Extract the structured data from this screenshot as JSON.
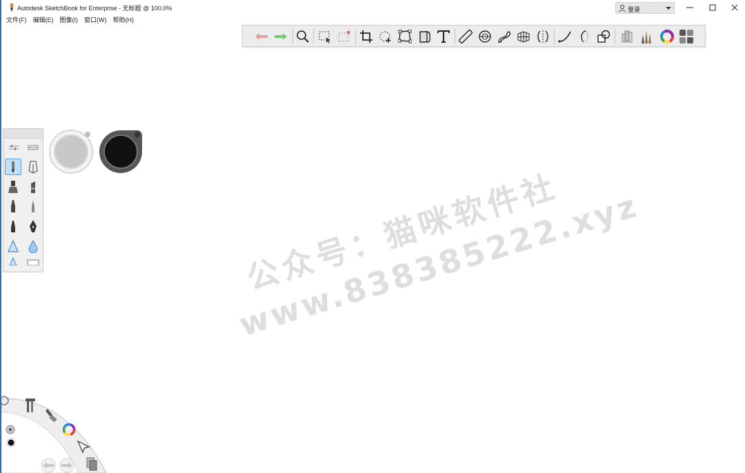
{
  "window": {
    "title": "Autodesk SketchBook for Enterprise - 无标题 @ 100.0%",
    "login_label": "登录",
    "controls": [
      "minimize",
      "maximize",
      "close"
    ]
  },
  "menu": {
    "items": [
      "文件(F)",
      "编辑(E)",
      "图像(I)",
      "窗口(W)",
      "帮助(H)"
    ]
  },
  "toolbar": {
    "tools": [
      "undo-icon",
      "redo-icon",
      "zoom-icon",
      "select-icon",
      "transform-select-icon",
      "crop-icon",
      "move-rotate-icon",
      "distort-icon",
      "layer-fill-icon",
      "text-icon",
      "ruler-icon",
      "ellipse-guide-icon",
      "french-curve-icon",
      "perspective-icon",
      "symmetry-icon",
      "stroke-icon",
      "predictive-stroke-icon",
      "shape-icon",
      "copic-library-icon",
      "brush-library-icon",
      "color-wheel-icon",
      "layer-editor-icon"
    ]
  },
  "brush_palette": {
    "brushes": [
      "pencil-icon",
      "ink-pen-icon",
      "marker-icon",
      "chisel-marker-icon",
      "felt-pen-icon",
      "fine-tip-icon",
      "ballpoint-icon",
      "fountain-pen-icon",
      "airbrush-icon",
      "water-drop-icon",
      "triangle-brush-icon",
      "eraser-icon"
    ],
    "selected": "pencil-icon"
  },
  "colors": {
    "fill_puck": "#c8c8c8",
    "stroke_puck": "#111111",
    "accent": "#2b6fb6",
    "redo": "#7cc67c",
    "undo": "#e3a0a0"
  },
  "watermark": {
    "line1": "公众号：猫咪软件社",
    "line2": "www.838385222.xyz"
  }
}
